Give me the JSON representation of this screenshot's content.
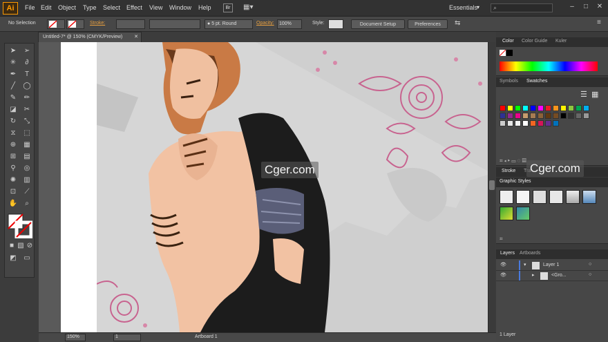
{
  "app": {
    "logo": "Ai",
    "bridge_label": "Br"
  },
  "menu": [
    "File",
    "Edit",
    "Object",
    "Type",
    "Select",
    "Effect",
    "View",
    "Window",
    "Help"
  ],
  "workspace": "Essentials",
  "control": {
    "selection_label": "No Selection",
    "stroke_label": "Stroke:",
    "brush_label": "5 pt. Round",
    "opacity_label": "Opacity:",
    "opacity_value": "100%",
    "style_label": "Style:",
    "doc_setup_button": "Document Setup",
    "preferences_button": "Preferences"
  },
  "document": {
    "tab_title": "Untitled-7* @ 150% (CMYK/Preview)"
  },
  "status": {
    "zoom": "150%",
    "artboard_num": "1",
    "artboard_label": "Artboard 1"
  },
  "panels": {
    "color_tabs": [
      "Color",
      "Color Guide",
      "Kuler"
    ],
    "swatch_tabs": [
      "Symbols",
      "Swatches"
    ],
    "stroke_tabs": [
      "Stroke",
      "Tra"
    ],
    "graphic_styles_title": "Graphic Styles",
    "layer_tabs": [
      "Layers",
      "Artboards"
    ],
    "layers": [
      {
        "name": "Layer 1"
      },
      {
        "name": "<Gro..."
      }
    ],
    "layers_count": "1 Layer"
  },
  "swatch_colors": [
    "#ff0000",
    "#ffff00",
    "#00ff00",
    "#00ffff",
    "#0000ff",
    "#ff00ff",
    "#ed1c24",
    "#f7941d",
    "#fff200",
    "#8dc63f",
    "#00a651",
    "#00aeef",
    "#2e3192",
    "#92278f",
    "#ec008c",
    "#c69c6d",
    "#a67c52",
    "#8c6239",
    "#603913",
    "#754c24",
    "#000000",
    "#333333",
    "#666666",
    "#999999",
    "#cccccc",
    "#e6e6e6",
    "#f2f2f2",
    "#ffffff",
    "#f26522",
    "#d4145a",
    "#662d91",
    "#0072bc"
  ],
  "watermarks": [
    "Cger.com",
    "Cger.com"
  ],
  "colors": {
    "accent": "#ff9a00",
    "panel": "#474747",
    "dark": "#323232"
  }
}
